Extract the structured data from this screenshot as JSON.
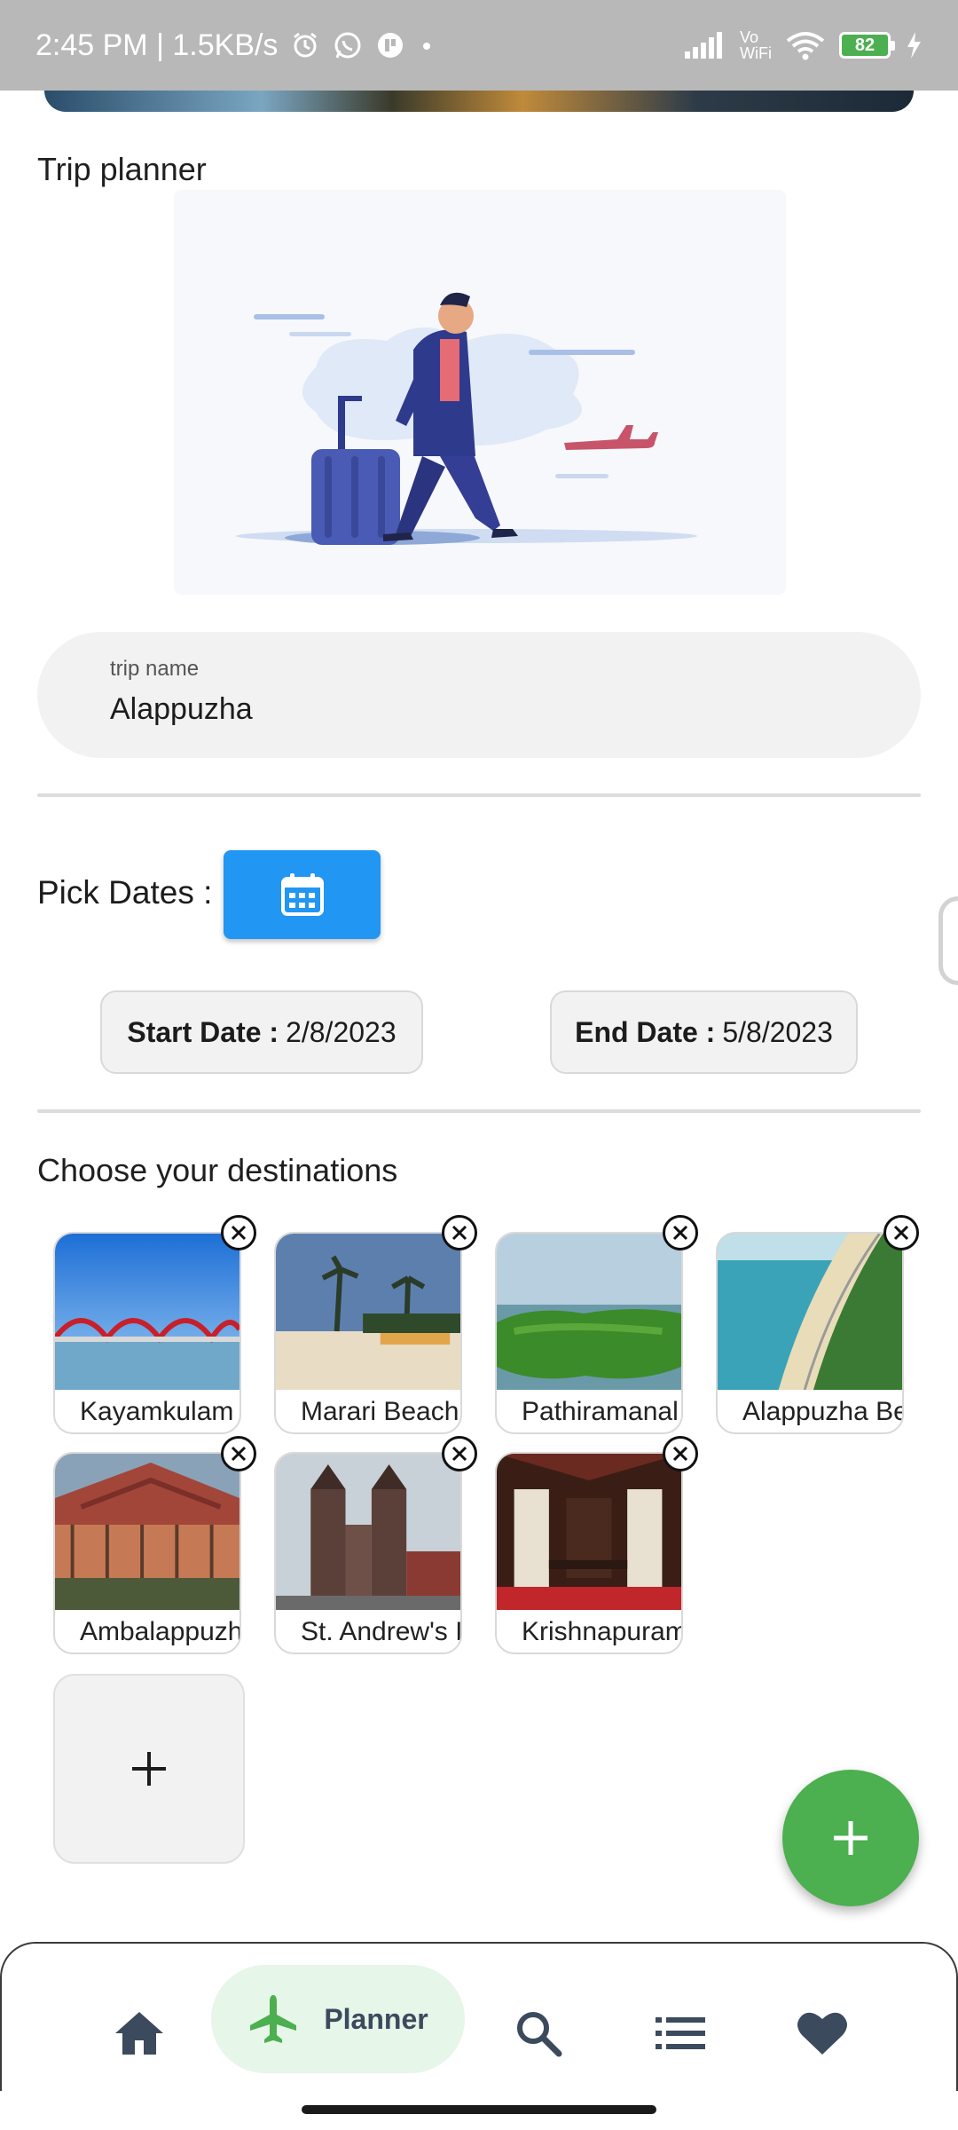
{
  "status_bar": {
    "time_speed": "2:45 PM | 1.5KB/s",
    "vowifi_top": "Vo",
    "vowifi_bottom": "WiFi",
    "battery": "82"
  },
  "planner": {
    "title": "Trip planner",
    "trip_name_label": "trip name",
    "trip_name_value": "Alappuzha",
    "pick_dates_label": "Pick Dates :",
    "start_date_label": "Start Date :",
    "start_date_value": "2/8/2023",
    "end_date_label": "End Date :",
    "end_date_value": "5/8/2023",
    "destinations_title": "Choose your destinations",
    "destinations": [
      {
        "name": "Kayamkulam"
      },
      {
        "name": "Marari Beach"
      },
      {
        "name": "Pathiramanal"
      },
      {
        "name": "Alappuzha Be"
      },
      {
        "name": "Ambalappuzh"
      },
      {
        "name": "St. Andrew's I"
      },
      {
        "name": "Krishnapuram"
      }
    ]
  },
  "bottom_nav": {
    "active_label": "Planner",
    "items": [
      "home",
      "planner",
      "search",
      "list",
      "favorites"
    ]
  },
  "colors": {
    "accent_blue": "#2196f3",
    "fab_green": "#4caf50",
    "nav_active_bg": "#e6f6e8",
    "nav_icon": "#3c4a5e"
  }
}
